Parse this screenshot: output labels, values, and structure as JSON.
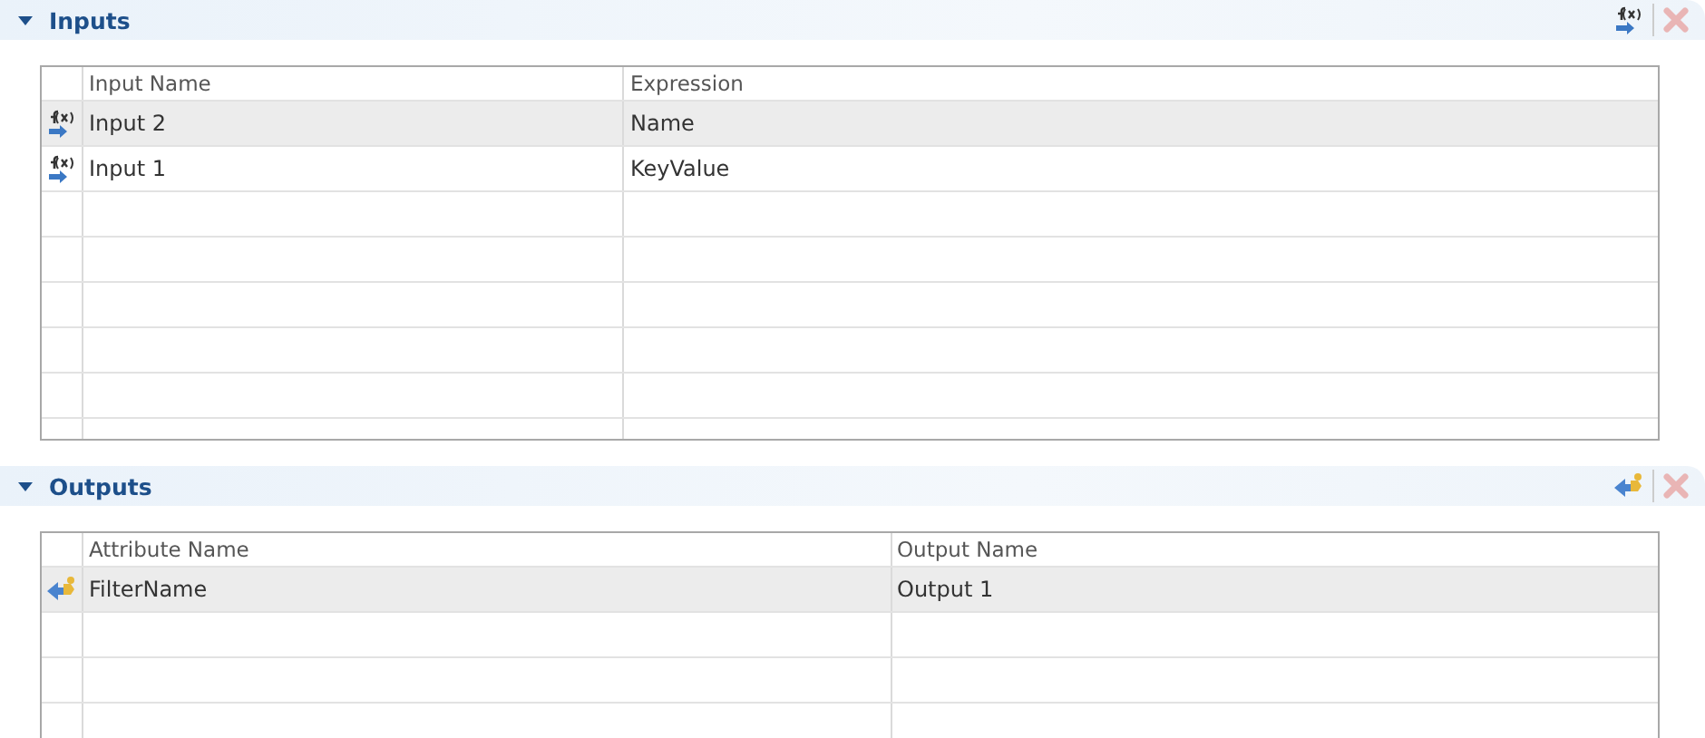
{
  "sections": [
    {
      "title": "Inputs",
      "expanded": true,
      "delete_disabled": true,
      "columns": [
        "Input Name",
        "Expression"
      ],
      "rows": [
        {
          "cells": [
            "Input 2",
            "Name"
          ],
          "selected": true
        },
        {
          "cells": [
            "Input 1",
            "KeyValue"
          ],
          "selected": false
        }
      ]
    },
    {
      "title": "Outputs",
      "expanded": true,
      "delete_disabled": true,
      "columns": [
        "Attribute Name",
        "Output Name"
      ],
      "rows": [
        {
          "cells": [
            "FilterName",
            "Output 1"
          ],
          "selected": true
        }
      ]
    }
  ]
}
